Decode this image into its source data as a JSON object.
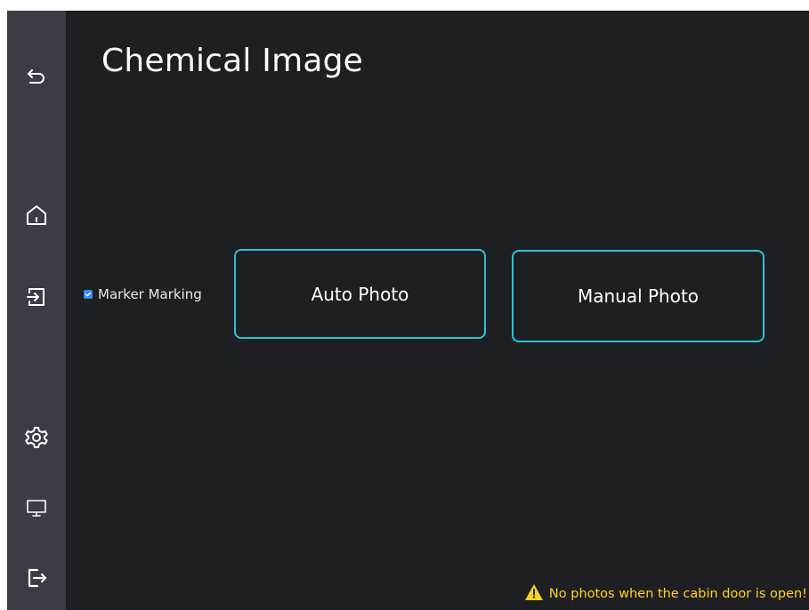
{
  "page": {
    "title": "Chemical Image"
  },
  "sidebar": {
    "items": [
      {
        "icon": "back-icon"
      },
      {
        "icon": "home-icon"
      },
      {
        "icon": "login-icon"
      },
      {
        "icon": "settings-icon"
      },
      {
        "icon": "monitor-icon"
      },
      {
        "icon": "logout-icon"
      }
    ]
  },
  "options": {
    "marker_label": "Marker Marking",
    "marker_checked": true
  },
  "actions": {
    "auto_photo": "Auto Photo",
    "manual_photo": "Manual Photo"
  },
  "status": {
    "warning": "No photos when the cabin door is open!"
  },
  "colors": {
    "accent": "#27c4d4",
    "warning": "#ffd21f",
    "checkbox": "#2f8cf0",
    "sidebar": "#3a3d44",
    "background": "#1e1f23"
  }
}
